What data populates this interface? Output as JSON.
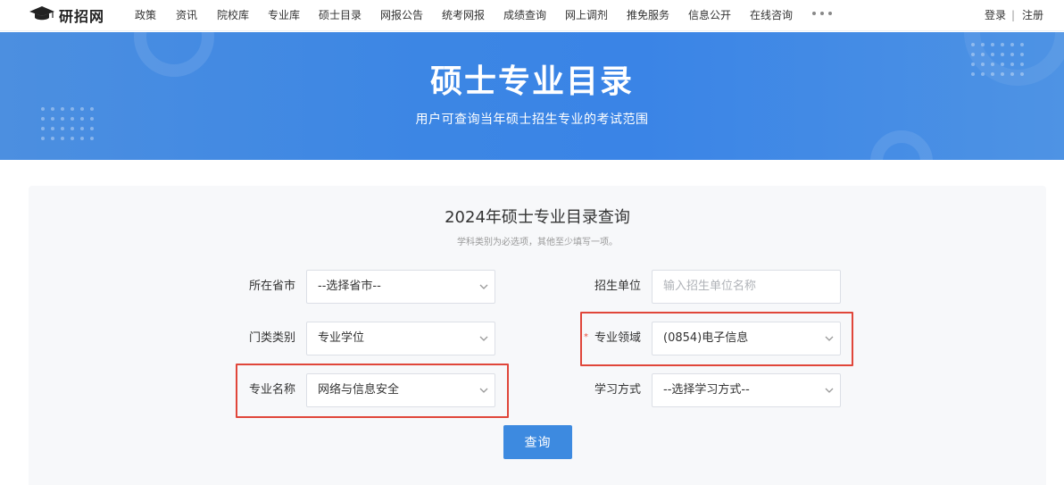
{
  "brand": {
    "logo_text": "研招网"
  },
  "nav": {
    "items": [
      "政策",
      "资讯",
      "院校库",
      "专业库",
      "硕士目录",
      "网报公告",
      "统考网报",
      "成绩查询",
      "网上调剂",
      "推免服务",
      "信息公开",
      "在线咨询"
    ],
    "more_icon": "more-dots-icon"
  },
  "auth": {
    "login": "登录",
    "separator": "|",
    "register": "注册"
  },
  "banner": {
    "title": "硕士专业目录",
    "subtitle": "用户可查询当年硕士招生专业的考试范围"
  },
  "search": {
    "title": "2024年硕士专业目录查询",
    "hint": "学科类别为必选项，其他至少填写一项。",
    "province_label": "所在省市",
    "province_value": "--选择省市--",
    "unit_label": "招生单位",
    "unit_placeholder": "输入招生单位名称",
    "category_label": "门类类别",
    "category_value": "专业学位",
    "field_label": "专业领域",
    "field_required_mark": "*",
    "field_value": "(0854)电子信息",
    "major_label": "专业名称",
    "major_value": "网络与信息安全",
    "mode_label": "学习方式",
    "mode_value": "--选择学习方式--",
    "query_button": "查询"
  },
  "colors": {
    "banner_blue": "#3c86e4",
    "button_blue": "#3d8ae0",
    "highlight_red": "#e0463a",
    "required_red": "#e74c3c"
  }
}
